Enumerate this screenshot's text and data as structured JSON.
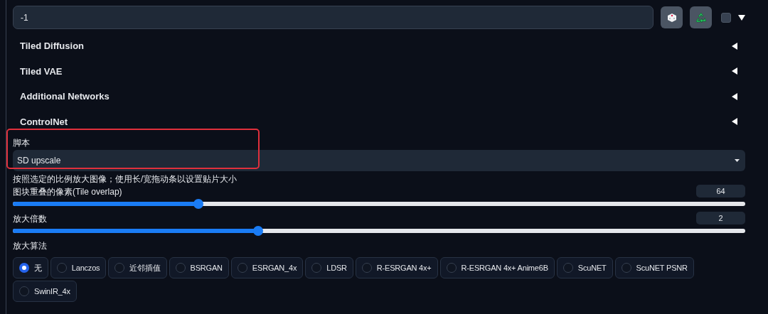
{
  "seed": {
    "value": "-1",
    "checked": false
  },
  "accordions": [
    {
      "label": "Tiled Diffusion",
      "expanded": false
    },
    {
      "label": "Tiled VAE",
      "expanded": false
    },
    {
      "label": "Additional Networks",
      "expanded": false
    },
    {
      "label": "ControlNet",
      "expanded": false
    }
  ],
  "script": {
    "label": "脚本",
    "value": "SD upscale"
  },
  "description": "按照选定的比例放大图像；使用长/宽拖动条以设置贴片大小",
  "sliders": [
    {
      "label": "图块重叠的像素(Tile overlap)",
      "value": "64",
      "level": 0.253
    },
    {
      "label": "放大倍数",
      "value": "2",
      "level": 0.335
    }
  ],
  "upscaler": {
    "label": "放大算法",
    "options": [
      {
        "label": "无",
        "selected": true
      },
      {
        "label": "Lanczos",
        "selected": false
      },
      {
        "label": "近邻插值",
        "selected": false
      },
      {
        "label": "BSRGAN",
        "selected": false
      },
      {
        "label": "ESRGAN_4x",
        "selected": false
      },
      {
        "label": "LDSR",
        "selected": false
      },
      {
        "label": "R-ESRGAN 4x+",
        "selected": false
      },
      {
        "label": "R-ESRGAN 4x+ Anime6B",
        "selected": false
      },
      {
        "label": "ScuNET",
        "selected": false
      },
      {
        "label": "ScuNET PSNR",
        "selected": false
      },
      {
        "label": "SwinIR_4x",
        "selected": false
      }
    ]
  }
}
